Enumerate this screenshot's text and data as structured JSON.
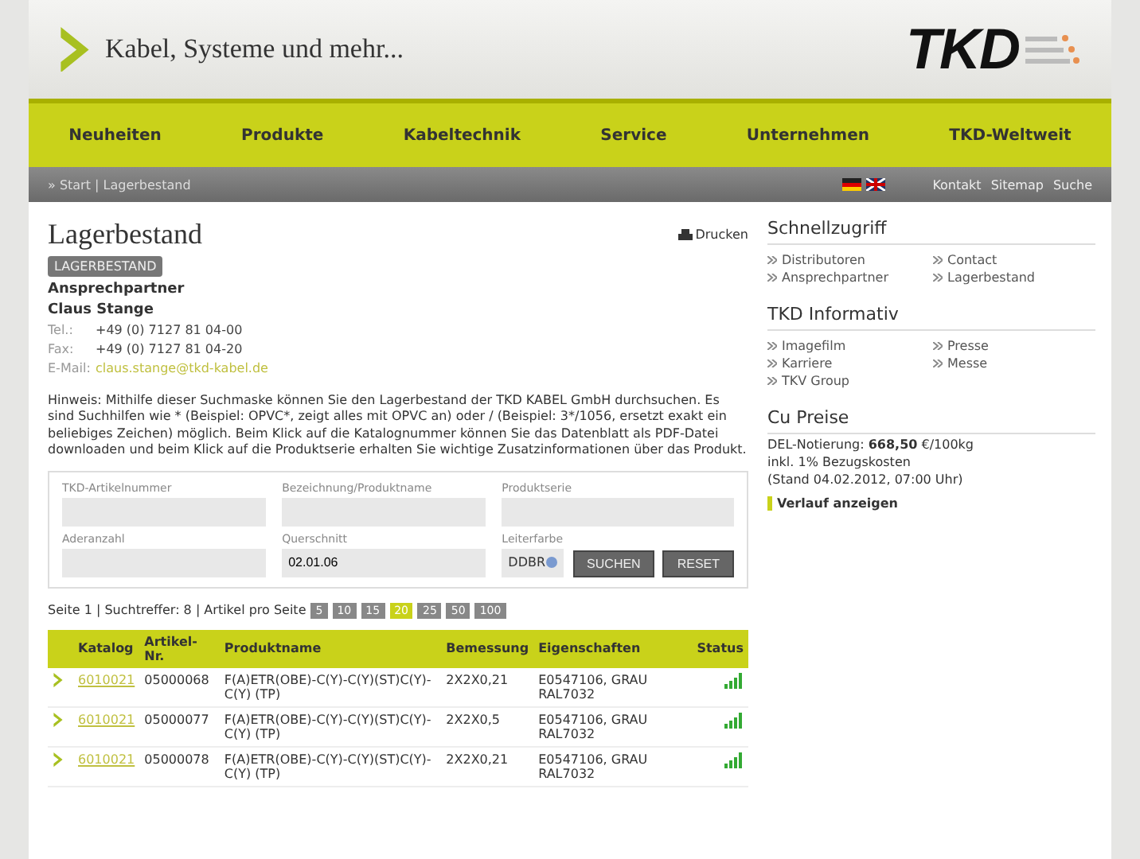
{
  "header": {
    "slogan": "Kabel, Systeme und mehr...",
    "logo": "TKD"
  },
  "nav": [
    {
      "label": "Neuheiten"
    },
    {
      "label": "Produkte"
    },
    {
      "label": "Kabeltechnik"
    },
    {
      "label": "Service"
    },
    {
      "label": "Unternehmen"
    },
    {
      "label": "TKD-Weltweit"
    }
  ],
  "subbar": {
    "breadcrumb": "» Start | Lagerbestand",
    "links": [
      "Kontakt",
      "Sitemap",
      "Suche"
    ]
  },
  "main": {
    "title": "Lagerbestand",
    "print": "Drucken",
    "badge": "LAGERBESTAND",
    "contact": {
      "heading": "Ansprechpartner",
      "name": "Claus Stange",
      "lines": [
        {
          "label": "Tel.:",
          "value": "+49 (0) 7127 81 04-00",
          "kind": "text"
        },
        {
          "label": "Fax:",
          "value": "+49 (0) 7127 81 04-20",
          "kind": "text"
        },
        {
          "label": "E-Mail:",
          "value": "claus.stange@tkd-kabel.de",
          "kind": "link"
        }
      ]
    },
    "hint": "Hinweis: Mithilfe dieser Suchmaske können Sie den Lagerbestand der TKD KABEL GmbH durchsuchen. Es sind Suchhilfen wie * (Beispiel: OPVC*, zeigt alles mit OPVC an) oder / (Beispiel: 3*/1056, ersetzt exakt ein beliebiges Zeichen) möglich. Beim Klick auf die Katalognummer können Sie das Datenblatt als PDF-Datei downloaden und beim Klick auf die Produktserie erhalten Sie wichtige Zusatzinformationen über das Produkt.",
    "form": {
      "fields": [
        {
          "label": "TKD-Artikelnummer",
          "kind": "input"
        },
        {
          "label": "Bezeichnung/Produktname",
          "kind": "input"
        },
        {
          "label": "Produktserie",
          "kind": "input"
        },
        {
          "label": "Aderanzahl",
          "kind": "input"
        },
        {
          "label": "Querschnitt",
          "kind": "input",
          "value": "02.01.06"
        },
        {
          "label": "Leiterfarbe",
          "kind": "select",
          "value": "DDBR"
        }
      ],
      "buttons": [
        "SUCHEN",
        "RESET"
      ]
    },
    "results": {
      "summary": "Seite 1 | Suchtreffer: 8 | Artikel pro Seite",
      "page_sizes": [
        {
          "label": "5",
          "selected": false
        },
        {
          "label": "10",
          "selected": false
        },
        {
          "label": "15",
          "selected": false
        },
        {
          "label": "20",
          "selected": true
        },
        {
          "label": "25",
          "selected": false
        },
        {
          "label": "50",
          "selected": false
        },
        {
          "label": "100",
          "selected": false
        }
      ]
    },
    "table": {
      "columns": [
        "Katalog",
        "Artikel-Nr.",
        "Produktname",
        "Bemessung",
        "Eigenschaften",
        "Status"
      ],
      "rows": [
        {
          "katalog": "6010021",
          "artikel": "05000068",
          "produkt": "F(A)ETR(OBE)-C(Y)-C(Y)(ST)C(Y)-C(Y) (TP)",
          "bemessung": "2X2X0,21",
          "eigenschaften": "E0547106, GRAU RAL7032"
        },
        {
          "katalog": "6010021",
          "artikel": "05000077",
          "produkt": "F(A)ETR(OBE)-C(Y)-C(Y)(ST)C(Y)-C(Y) (TP)",
          "bemessung": "2X2X0,5",
          "eigenschaften": "E0547106, GRAU RAL7032"
        },
        {
          "katalog": "6010021",
          "artikel": "05000078",
          "produkt": "F(A)ETR(OBE)-C(Y)-C(Y)(ST)C(Y)-C(Y) (TP)",
          "bemessung": "2X2X0,21",
          "eigenschaften": "E0547106, GRAU RAL7032"
        }
      ]
    }
  },
  "sidebar": {
    "sections": [
      {
        "title": "Schnellzugriff",
        "kind": "links",
        "links": [
          "Distributoren",
          "Contact",
          "Ansprechpartner",
          "Lagerbestand"
        ]
      },
      {
        "title": "TKD Informativ",
        "kind": "links",
        "links": [
          "Imagefilm",
          "Presse",
          "Karriere",
          "Messe",
          "TKV Group"
        ]
      },
      {
        "title": "Cu Preise",
        "kind": "prices",
        "lines": [
          "DEL-Notierung: **668,50** €/100kg",
          "inkl. 1% Bezugskosten",
          "(Stand 04.02.2012, 07:00 Uhr)"
        ],
        "link": "Verlauf anzeigen"
      }
    ]
  }
}
